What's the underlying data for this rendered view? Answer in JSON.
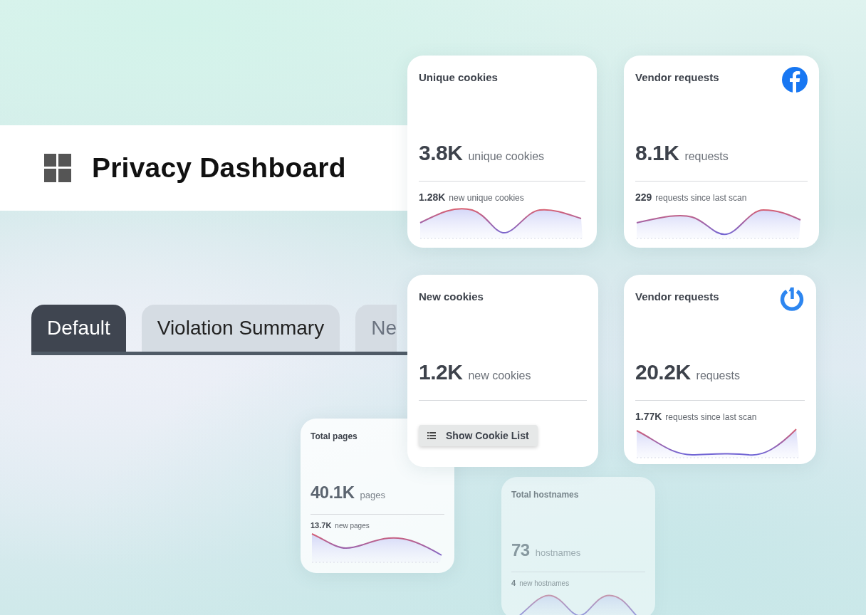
{
  "header": {
    "title": "Privacy Dashboard"
  },
  "tabs": [
    {
      "label": "Default",
      "selected": true
    },
    {
      "label": "Violation Summary",
      "selected": false
    },
    {
      "label": "Ne",
      "selected": false
    }
  ],
  "cards": [
    {
      "title": "Unique cookies",
      "value": "3.8K",
      "unit": "unique cookies",
      "kind": "sparkline",
      "delta": "1.28K",
      "delta_label": "new unique cookies",
      "faded": false
    },
    {
      "title": "Vendor requests",
      "value": "8.1K",
      "unit": "requests",
      "kind": "sparkline",
      "delta": "229",
      "delta_label": "requests since last scan",
      "faded": false
    },
    {
      "title": "New cookies",
      "value": "1.2K",
      "unit": "new cookies",
      "kind": "button",
      "button": "Show Cookie List",
      "faded": false
    },
    {
      "title": "Vendor requests",
      "value": "20.2K",
      "unit": "requests",
      "kind": "sparkline",
      "delta": "1.77K",
      "delta_label": "requests since last scan",
      "faded": false
    },
    {
      "title": "Total pages",
      "value": "40.1K",
      "unit": "pages",
      "kind": "sparkline",
      "delta": "13.7K",
      "delta_label": "new pages",
      "faded": false
    },
    {
      "title": "Total hostnames",
      "value": "73",
      "unit": "hostnames",
      "kind": "sparkline",
      "delta": "4",
      "delta_label": "new hostnames",
      "faded": true
    }
  ]
}
